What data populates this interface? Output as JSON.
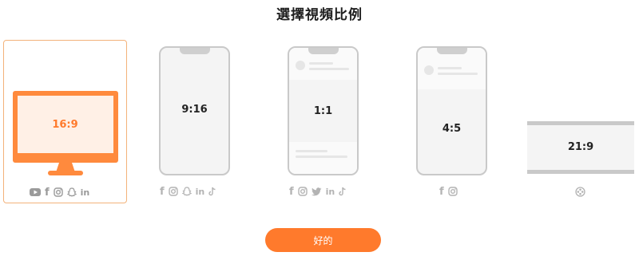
{
  "dialog": {
    "title": "選擇視頻比例"
  },
  "options": [
    {
      "ratio": "16:9",
      "selected": true,
      "platforms": [
        "youtube",
        "facebook",
        "instagram",
        "snapchat",
        "linkedin"
      ]
    },
    {
      "ratio": "9:16",
      "selected": false,
      "platforms": [
        "facebook",
        "instagram",
        "snapchat",
        "linkedin",
        "tiktok"
      ]
    },
    {
      "ratio": "1:1",
      "selected": false,
      "platforms": [
        "facebook",
        "instagram",
        "twitter",
        "linkedin",
        "tiktok"
      ]
    },
    {
      "ratio": "4:5",
      "selected": false,
      "platforms": [
        "facebook",
        "instagram"
      ]
    },
    {
      "ratio": "21:9",
      "selected": false,
      "platforms": [
        "film-reel"
      ]
    }
  ],
  "icon_glyphs": {
    "facebook": "f",
    "linkedin": "in"
  },
  "confirm_button": {
    "label": "好的"
  },
  "colors": {
    "accent": "#ff7a2c",
    "selected_border": "#f3b27a",
    "screen_fill": "#fff0e6",
    "frame_gray": "#c9c9c9",
    "icon_gray": "#b3b3b3"
  }
}
